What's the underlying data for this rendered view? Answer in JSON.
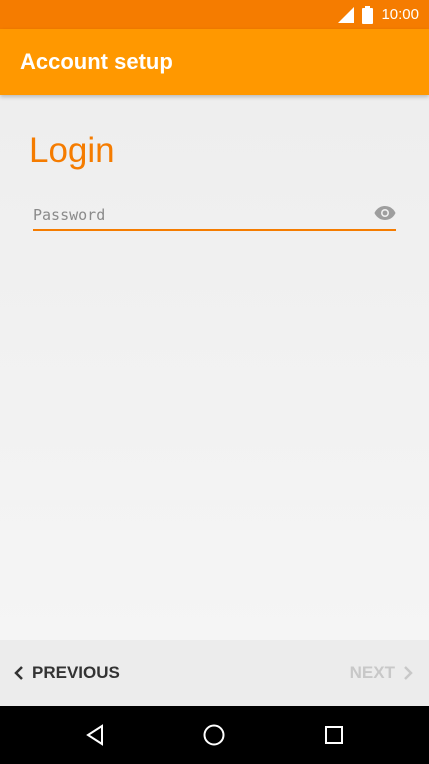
{
  "status_bar": {
    "time": "10:00",
    "icons": [
      "signal-icon",
      "battery-icon"
    ],
    "color": "#f57c00"
  },
  "app_bar": {
    "title": "Account setup",
    "color": "#ff9800"
  },
  "main": {
    "heading": "Login",
    "password": {
      "placeholder": "Password",
      "value": "",
      "toggle_icon": "eye-icon"
    },
    "accent_color": "#f57c00"
  },
  "bottom_nav": {
    "previous_label": "PREVIOUS",
    "next_label": "NEXT",
    "next_enabled": false
  },
  "system_nav": {
    "buttons": [
      "back-icon",
      "home-icon",
      "recents-icon"
    ]
  }
}
